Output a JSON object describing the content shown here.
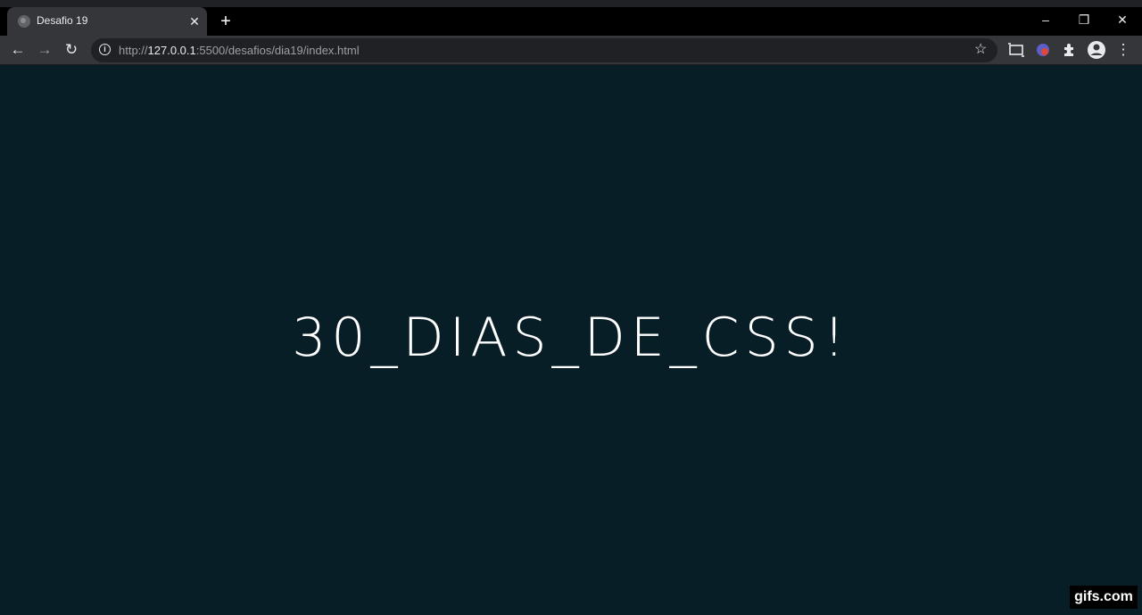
{
  "browser": {
    "tab": {
      "title": "Desafio 19",
      "close_glyph": "✕"
    },
    "new_tab_glyph": "+",
    "window_controls": {
      "minimize_glyph": "–",
      "restore_glyph": "❐",
      "close_glyph": "✕"
    },
    "toolbar": {
      "back_glyph": "←",
      "forward_glyph": "→",
      "reload_glyph": "↻",
      "star_glyph": "☆",
      "menu_glyph": "⋮"
    },
    "address": {
      "scheme": "http://",
      "host": "127.0.0.1",
      "rest": ":5500/desafios/dia19/index.html"
    }
  },
  "page": {
    "headline": "30_DIAS_DE_CSS!"
  },
  "watermark": "gifs.com",
  "colors": {
    "page_background": "#071e26",
    "text": "#ffffff",
    "toolbar": "#35363a",
    "tabstrip": "#000000"
  }
}
